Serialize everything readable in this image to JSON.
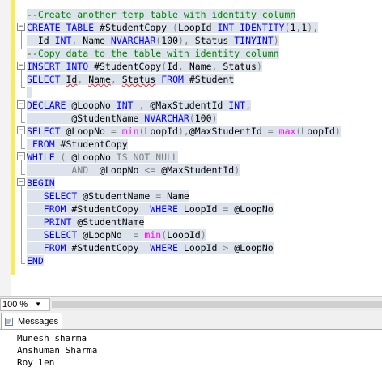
{
  "editor": {
    "lines": [
      [
        [
          "cm",
          "--Create another temp table with identity column"
        ]
      ],
      [
        [
          "kw",
          "CREATE TABLE "
        ],
        [
          "bl",
          "#StudentCopy "
        ],
        [
          "gr",
          "("
        ],
        [
          "bl",
          "LoopId "
        ],
        [
          "kw",
          "INT IDENTITY"
        ],
        [
          "gr",
          "("
        ],
        [
          "bl",
          "1"
        ],
        [
          "gr",
          ","
        ],
        [
          "bl",
          "1"
        ],
        [
          "gr",
          "),"
        ]
      ],
      [
        [
          "bl",
          "  Id "
        ],
        [
          "kw",
          "INT"
        ],
        [
          "gr",
          ", "
        ],
        [
          "bl",
          "Name "
        ],
        [
          "kw",
          "NVARCHAR"
        ],
        [
          "gr",
          "("
        ],
        [
          "bl",
          "100"
        ],
        [
          "gr",
          "), "
        ],
        [
          "bl",
          "Status "
        ],
        [
          "kw",
          "TINYINT"
        ],
        [
          "gr",
          ")"
        ]
      ],
      [
        [
          "cm",
          "--Copy data to the table with identity column"
        ]
      ],
      [
        [
          "kw",
          "INSERT INTO "
        ],
        [
          "bl",
          "#StudentCopy"
        ],
        [
          "gr",
          "("
        ],
        [
          "bl",
          "Id"
        ],
        [
          "gr",
          ", "
        ],
        [
          "bl",
          "Name"
        ],
        [
          "gr",
          ", "
        ],
        [
          "bl",
          "Status"
        ],
        [
          "gr",
          ")"
        ]
      ],
      [
        [
          "kw",
          "SELECT "
        ],
        [
          "bl",
          "Id"
        ],
        [
          "gr",
          ", "
        ],
        [
          "bl",
          "Name"
        ],
        [
          "gr",
          ", "
        ],
        [
          "bl",
          "Status "
        ],
        [
          "kw",
          "FROM "
        ],
        [
          "bl",
          "#Student"
        ]
      ],
      [],
      [
        [
          "kw",
          "DECLARE "
        ],
        [
          "bl",
          "@LoopNo "
        ],
        [
          "kw",
          "INT "
        ],
        [
          "gr",
          ", "
        ],
        [
          "bl",
          "@MaxStudentId "
        ],
        [
          "kw",
          "INT"
        ],
        [
          "gr",
          ","
        ]
      ],
      [
        [
          "bl",
          "        @StudentName "
        ],
        [
          "kw",
          "NVARCHAR"
        ],
        [
          "gr",
          "("
        ],
        [
          "bl",
          "100"
        ],
        [
          "gr",
          ")"
        ]
      ],
      [
        [
          "kw",
          "SELECT "
        ],
        [
          "bl",
          "@LoopNo "
        ],
        [
          "gr",
          "= "
        ],
        [
          "fn",
          "min"
        ],
        [
          "gr",
          "("
        ],
        [
          "bl",
          "LoopId"
        ],
        [
          "gr",
          "),"
        ],
        [
          "bl",
          "@MaxStudentId "
        ],
        [
          "gr",
          "= "
        ],
        [
          "fn",
          "max"
        ],
        [
          "gr",
          "("
        ],
        [
          "bl",
          "LoopId"
        ],
        [
          "gr",
          ")"
        ]
      ],
      [
        [
          "kw",
          " FROM "
        ],
        [
          "bl",
          "#StudentCopy"
        ]
      ],
      [
        [
          "kw",
          "WHILE "
        ],
        [
          "gr",
          "( "
        ],
        [
          "bl",
          "@LoopNo "
        ],
        [
          "gr",
          "IS NOT NULL"
        ]
      ],
      [
        [
          "bl",
          "        "
        ],
        [
          "gr",
          "AND  "
        ],
        [
          "bl",
          "@LoopNo "
        ],
        [
          "gr",
          "<= "
        ],
        [
          "bl",
          "@MaxStudentId"
        ],
        [
          "gr",
          ")"
        ]
      ],
      [
        [
          "kw",
          "BEGIN"
        ]
      ],
      [
        [
          "bl",
          "   "
        ],
        [
          "kw",
          "SELECT "
        ],
        [
          "bl",
          "@StudentName "
        ],
        [
          "gr",
          "= "
        ],
        [
          "bl",
          "Name"
        ]
      ],
      [
        [
          "bl",
          "   "
        ],
        [
          "kw",
          "FROM "
        ],
        [
          "bl",
          "#StudentCopy  "
        ],
        [
          "kw",
          "WHERE "
        ],
        [
          "bl",
          "LoopId "
        ],
        [
          "gr",
          "= "
        ],
        [
          "bl",
          "@LoopNo"
        ]
      ],
      [
        [
          "bl",
          "   "
        ],
        [
          "kw",
          "PRINT "
        ],
        [
          "bl",
          "@StudentName"
        ]
      ],
      [
        [
          "bl",
          "   "
        ],
        [
          "kw",
          "SELECT "
        ],
        [
          "bl",
          "@LoopNo  "
        ],
        [
          "gr",
          "= "
        ],
        [
          "fn",
          "min"
        ],
        [
          "gr",
          "("
        ],
        [
          "bl",
          "LoopId"
        ],
        [
          "gr",
          ")"
        ]
      ],
      [
        [
          "bl",
          "   "
        ],
        [
          "kw",
          "FROM "
        ],
        [
          "bl",
          "#StudentCopy  "
        ],
        [
          "kw",
          "WHERE "
        ],
        [
          "bl",
          "LoopId "
        ],
        [
          "gr",
          "> "
        ],
        [
          "bl",
          "@LoopNo"
        ]
      ],
      [
        [
          "kw",
          "END"
        ]
      ]
    ],
    "colors": {
      "keyword": "#0000ff",
      "function": "#ff00ff",
      "comment": "#008000",
      "operator": "#808080",
      "selection": "#dde3ec",
      "change_bar": "#f7ec5a"
    }
  },
  "status": {
    "zoom_value": "100 %",
    "zoom_arrow_icon": "dropdown-arrow-icon"
  },
  "results": {
    "tab_label": "Messages",
    "tab_icon": "messages-icon",
    "messages": [
      "Munesh sharma",
      "Anshuman Sharma",
      "Roy len"
    ]
  }
}
